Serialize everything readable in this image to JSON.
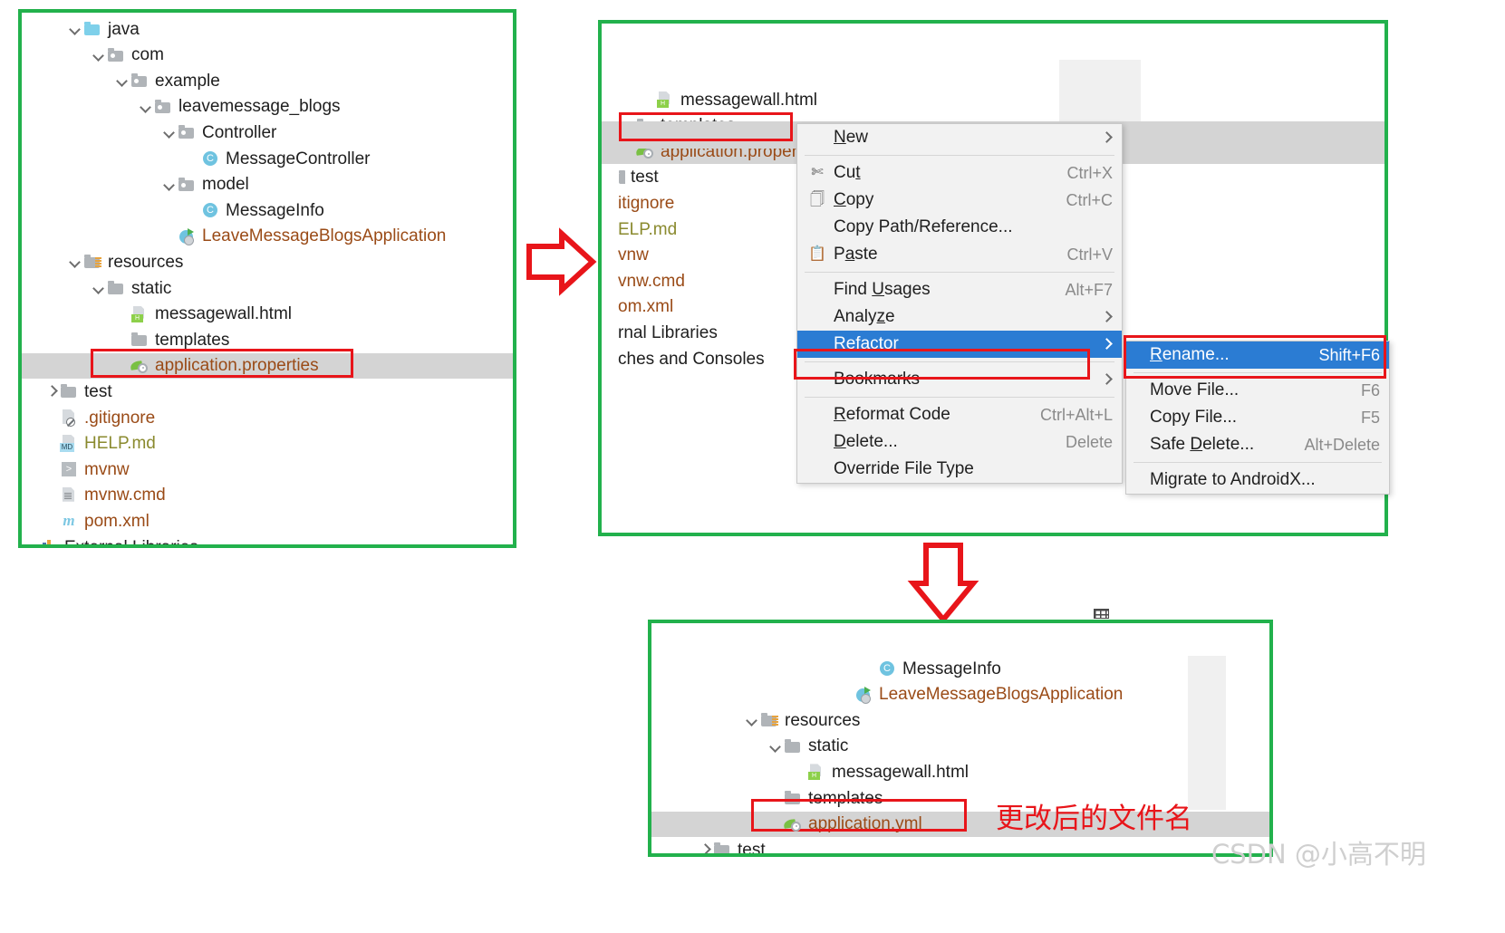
{
  "panels": {
    "left": {
      "name": "project-tree-before",
      "rows": [
        {
          "label": "java",
          "icon": "folder-src",
          "chevron": "down",
          "indent": 68,
          "color": "black",
          "selected": false
        },
        {
          "label": "com",
          "icon": "folder-pkg",
          "chevron": "down",
          "indent": 94,
          "color": "black",
          "selected": false
        },
        {
          "label": "example",
          "icon": "folder-pkg",
          "chevron": "down",
          "indent": 120,
          "color": "black",
          "selected": false
        },
        {
          "label": "leavemessage_blogs",
          "icon": "folder-pkg",
          "chevron": "down",
          "indent": 146,
          "color": "black",
          "selected": false
        },
        {
          "label": "Controller",
          "icon": "folder-pkg",
          "chevron": "down",
          "indent": 172,
          "color": "black",
          "selected": false
        },
        {
          "label": "MessageController",
          "icon": "class",
          "chevron": "none",
          "indent": 198,
          "color": "black",
          "selected": false
        },
        {
          "label": "model",
          "icon": "folder-pkg",
          "chevron": "down",
          "indent": 172,
          "color": "black",
          "selected": false
        },
        {
          "label": "MessageInfo",
          "icon": "class",
          "chevron": "none",
          "indent": 198,
          "color": "black",
          "selected": false
        },
        {
          "label": "LeaveMessageBlogsApplication",
          "icon": "spring-app",
          "chevron": "none",
          "indent": 172,
          "color": "orange",
          "selected": false
        },
        {
          "label": "resources",
          "icon": "folder-res",
          "chevron": "down",
          "indent": 68,
          "color": "black",
          "selected": false
        },
        {
          "label": "static",
          "icon": "folder",
          "chevron": "down",
          "indent": 94,
          "color": "black",
          "selected": false
        },
        {
          "label": "messagewall.html",
          "icon": "html",
          "chevron": "none",
          "indent": 120,
          "color": "black",
          "selected": false
        },
        {
          "label": "templates",
          "icon": "folder",
          "chevron": "none",
          "indent": 120,
          "color": "black",
          "selected": false
        },
        {
          "label": "application.properties",
          "icon": "spring-props",
          "chevron": "none",
          "indent": 120,
          "color": "orange",
          "selected": true
        },
        {
          "label": "test",
          "icon": "folder",
          "chevron": "right",
          "indent": 42,
          "color": "black",
          "selected": false
        },
        {
          "label": ".gitignore",
          "icon": "gitignore",
          "chevron": "none",
          "indent": 42,
          "color": "orange",
          "selected": false
        },
        {
          "label": "HELP.md",
          "icon": "markdown",
          "chevron": "none",
          "indent": 42,
          "color": "olive",
          "selected": false
        },
        {
          "label": "mvnw",
          "icon": "shell",
          "chevron": "none",
          "indent": 42,
          "color": "orange",
          "selected": false
        },
        {
          "label": "mvnw.cmd",
          "icon": "file",
          "chevron": "none",
          "indent": 42,
          "color": "orange",
          "selected": false
        },
        {
          "label": "pom.xml",
          "icon": "maven",
          "chevron": "none",
          "indent": 42,
          "color": "orange",
          "selected": false
        },
        {
          "label": "External Libraries",
          "icon": "libraries",
          "chevron": "none",
          "indent": 20,
          "color": "black",
          "selected": false
        }
      ]
    },
    "middle": {
      "name": "project-tree-with-context-menu",
      "rows": [
        {
          "label": "messagewall.html",
          "icon": "html",
          "chevron": "none",
          "indent": 60,
          "color": "black",
          "selected": false
        },
        {
          "label": "templates",
          "icon": "folder",
          "chevron": "none",
          "indent": 38,
          "color": "black",
          "selected": false
        },
        {
          "label": "application.proper",
          "icon": "spring-props",
          "chevron": "none",
          "indent": 38,
          "color": "orange",
          "selected": true
        },
        {
          "label": "test",
          "icon": "folder-clip",
          "chevron": "none",
          "indent": 2,
          "color": "black",
          "selected": false
        },
        {
          "label": "itignore",
          "icon": "none",
          "chevron": "none",
          "indent": 0,
          "color": "orange",
          "selected": false
        },
        {
          "label": "ELP.md",
          "icon": "none",
          "chevron": "none",
          "indent": 0,
          "color": "olive",
          "selected": false
        },
        {
          "label": "vnw",
          "icon": "none",
          "chevron": "none",
          "indent": 0,
          "color": "orange",
          "selected": false
        },
        {
          "label": "vnw.cmd",
          "icon": "none",
          "chevron": "none",
          "indent": 0,
          "color": "orange",
          "selected": false
        },
        {
          "label": "om.xml",
          "icon": "none",
          "chevron": "none",
          "indent": 0,
          "color": "orange",
          "selected": false
        },
        {
          "label": "rnal Libraries",
          "icon": "none",
          "chevron": "none",
          "indent": 0,
          "color": "black",
          "selected": false
        },
        {
          "label": "ches and Consoles",
          "icon": "none",
          "chevron": "none",
          "indent": 0,
          "color": "black",
          "selected": false
        }
      ]
    },
    "bottom": {
      "name": "project-tree-after",
      "annotation": "更改后的文件名",
      "rows": [
        {
          "label": "MessageInfo",
          "icon": "class",
          "chevron": "none",
          "indent": 250,
          "color": "black",
          "selected": false
        },
        {
          "label": "LeaveMessageBlogsApplication",
          "icon": "spring-app",
          "chevron": "none",
          "indent": 224,
          "color": "orange",
          "selected": false
        },
        {
          "label": "resources",
          "icon": "folder-res",
          "chevron": "down",
          "indent": 120,
          "color": "black",
          "selected": false
        },
        {
          "label": "static",
          "icon": "folder",
          "chevron": "down",
          "indent": 146,
          "color": "black",
          "selected": false
        },
        {
          "label": "messagewall.html",
          "icon": "html",
          "chevron": "none",
          "indent": 172,
          "color": "black",
          "selected": false
        },
        {
          "label": "templates",
          "icon": "folder",
          "chevron": "none",
          "indent": 146,
          "color": "black",
          "selected": false
        },
        {
          "label": "application.yml",
          "icon": "spring-props",
          "chevron": "none",
          "indent": 146,
          "color": "orange",
          "selected": true
        },
        {
          "label": "test",
          "icon": "folder",
          "chevron": "right",
          "indent": 68,
          "color": "black",
          "selected": false
        }
      ]
    }
  },
  "context_menu": {
    "name": "file-context-menu",
    "items": [
      {
        "label": "New",
        "accel": "",
        "icon": "none",
        "submenu": true,
        "highlighted": false,
        "mnemonic_index": 0,
        "separator_after": true
      },
      {
        "label": "Cut",
        "accel": "Ctrl+X",
        "icon": "scissors",
        "submenu": false,
        "highlighted": false,
        "mnemonic_index": 2,
        "separator_after": false
      },
      {
        "label": "Copy",
        "accel": "Ctrl+C",
        "icon": "copy",
        "submenu": false,
        "highlighted": false,
        "mnemonic_index": 0,
        "separator_after": false
      },
      {
        "label": "Copy Path/Reference...",
        "accel": "",
        "icon": "none",
        "submenu": false,
        "highlighted": false,
        "mnemonic_index": -1,
        "separator_after": false
      },
      {
        "label": "Paste",
        "accel": "Ctrl+V",
        "icon": "clipboard",
        "submenu": false,
        "highlighted": false,
        "mnemonic_index": 1,
        "separator_after": true
      },
      {
        "label": "Find Usages",
        "accel": "Alt+F7",
        "icon": "none",
        "submenu": false,
        "highlighted": false,
        "mnemonic_index": 5,
        "separator_after": false
      },
      {
        "label": "Analyze",
        "accel": "",
        "icon": "none",
        "submenu": true,
        "highlighted": false,
        "mnemonic_index": 5,
        "separator_after": false
      },
      {
        "label": "Refactor",
        "accel": "",
        "icon": "none",
        "submenu": true,
        "highlighted": true,
        "mnemonic_index": 0,
        "separator_after": true
      },
      {
        "label": "Bookmarks",
        "accel": "",
        "icon": "none",
        "submenu": true,
        "highlighted": false,
        "mnemonic_index": -1,
        "separator_after": true
      },
      {
        "label": "Reformat Code",
        "accel": "Ctrl+Alt+L",
        "icon": "none",
        "submenu": false,
        "highlighted": false,
        "mnemonic_index": 0,
        "separator_after": false
      },
      {
        "label": "Delete...",
        "accel": "Delete",
        "icon": "none",
        "submenu": false,
        "highlighted": false,
        "mnemonic_index": 0,
        "separator_after": false
      },
      {
        "label": "Override File Type",
        "accel": "",
        "icon": "none",
        "submenu": false,
        "highlighted": false,
        "mnemonic_index": -1,
        "separator_after": false
      }
    ]
  },
  "refactor_submenu": {
    "name": "refactor-submenu",
    "items": [
      {
        "label": "Rename...",
        "accel": "Shift+F6",
        "highlighted": true,
        "mnemonic_index": 0,
        "separator_after": true
      },
      {
        "label": "Move File...",
        "accel": "F6",
        "highlighted": false,
        "mnemonic_index": -1,
        "separator_after": false
      },
      {
        "label": "Copy File...",
        "accel": "F5",
        "highlighted": false,
        "mnemonic_index": -1,
        "separator_after": false
      },
      {
        "label": "Safe Delete...",
        "accel": "Alt+Delete",
        "highlighted": false,
        "mnemonic_index": 5,
        "separator_after": true
      },
      {
        "label": "Migrate to AndroidX...",
        "accel": "",
        "highlighted": false,
        "mnemonic_index": -1,
        "separator_after": false
      }
    ]
  },
  "watermark": {
    "text": "CSDN @小高不明"
  },
  "colors": {
    "panel_border": "#22b14c",
    "highlight_box": "#e8151a",
    "menu_selection": "#2b7cd3",
    "tree_selection": "#d4d4d4",
    "file_orange": "#9a4b17",
    "file_olive": "#8a8a2e",
    "arrow": "#e8151a"
  }
}
